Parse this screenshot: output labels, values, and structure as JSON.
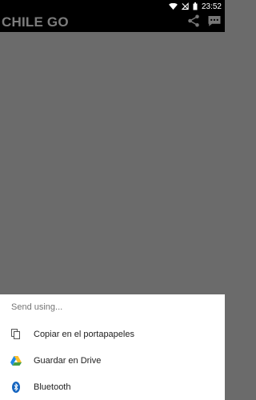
{
  "status_bar": {
    "time": "23:52"
  },
  "app_bar": {
    "title": "CHILE GO",
    "share_icon": "share-icon",
    "chat_icon": "chat-bubble-icon"
  },
  "share_sheet": {
    "title": "Send using...",
    "items": [
      {
        "label": "Copiar en el portapapeles",
        "icon": "copy-icon"
      },
      {
        "label": "Guardar en Drive",
        "icon": "google-drive-icon"
      },
      {
        "label": "Bluetooth",
        "icon": "bluetooth-icon"
      }
    ]
  },
  "colors": {
    "overlay_gray": "#6b6b6b",
    "bar_black": "#000000",
    "title_gray": "#7c7c7c",
    "sheet_white": "#ffffff",
    "bluetooth_blue": "#1565c0"
  }
}
